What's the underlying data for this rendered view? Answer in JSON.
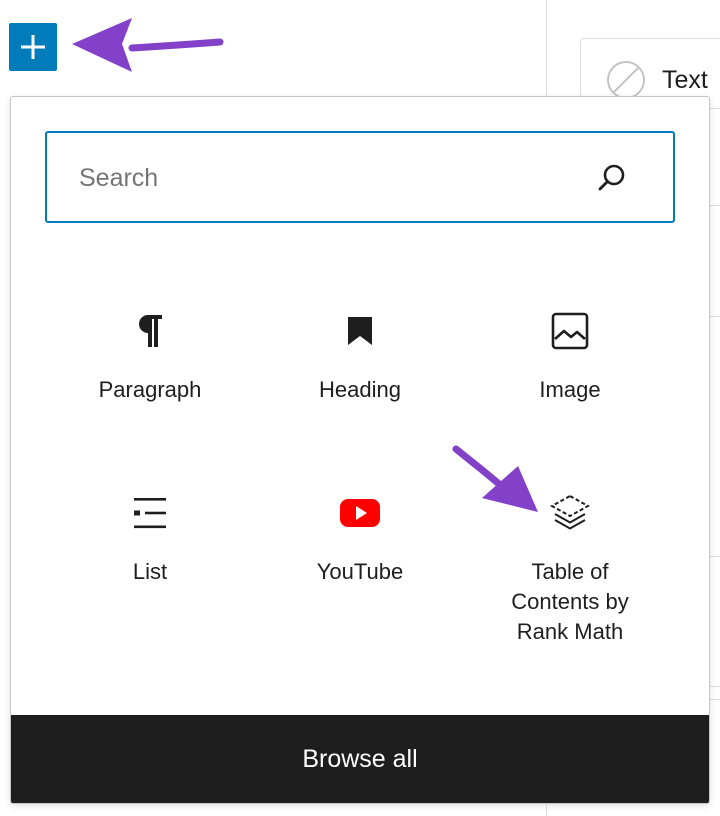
{
  "inserter": {
    "search": {
      "placeholder": "Search",
      "value": ""
    },
    "blocks": [
      {
        "label": "Paragraph",
        "icon": "paragraph-icon"
      },
      {
        "label": "Heading",
        "icon": "bookmark-heading-icon"
      },
      {
        "label": "Image",
        "icon": "image-icon"
      },
      {
        "label": "List",
        "icon": "list-icon"
      },
      {
        "label": "YouTube",
        "icon": "youtube-icon"
      },
      {
        "label": "Table of Contents by Rank Math",
        "icon": "layers-toc-icon"
      }
    ],
    "browse_all_label": "Browse all"
  },
  "sidebar": {
    "text_row_label": "Text",
    "text_row_icon": "disabled-circle-icon"
  },
  "colors": {
    "accent": "#007cba",
    "annotation_arrow": "#8241c8",
    "youtube": "#ff0000",
    "browse_bg": "#1e1e1e"
  }
}
